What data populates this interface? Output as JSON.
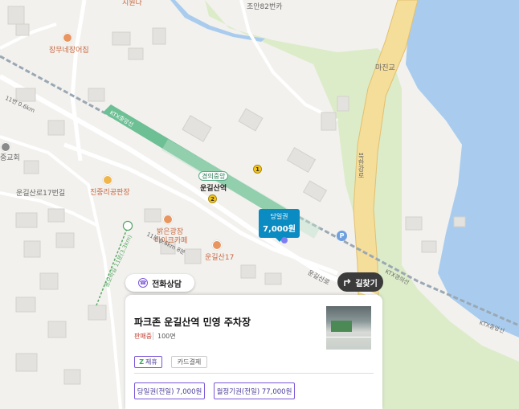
{
  "map": {
    "labels": {
      "top_cut": "지원다",
      "address_top": "조안82번카",
      "majin": "마진교",
      "road_vert": "북한강로",
      "church": "중교회",
      "road_17": "운길산로17번길",
      "road_11_left": "11번 0.6km",
      "road_11_mid": "11분 0.6km 8분",
      "path_left": "용모바길 11분(3.3km)",
      "unkil_road": "운길산로",
      "ktx_right": "KTX경의선",
      "ktx_far": "KTX중앙선",
      "ktx_green": "KTX중앙선"
    },
    "pois": {
      "restaurant": "장무네장어집",
      "jinjung": "진중리공판장",
      "balgeun_1": "밝은광장",
      "balgeun_2": "바이크카페",
      "unkil17": "운길산17"
    },
    "station": {
      "line": "경의중앙",
      "name": "운길산역",
      "exit1": "1",
      "exit2": "2"
    },
    "parking_badge": "P"
  },
  "price_tag": {
    "label": "당일권",
    "price": "7,000원"
  },
  "buttons": {
    "call": "전화상담",
    "navigate": "길찾기"
  },
  "card": {
    "title": "파크존 운길산역 민영 주차장",
    "status": "판매중",
    "spaces": "100면",
    "chips": {
      "partner": "제휴",
      "card_payment": "카드결제"
    },
    "tickets": {
      "day": "당일권(전일) 7,000원",
      "month": "월정기권(전일) 77,000원"
    }
  },
  "icons": [
    "phone-icon",
    "turn-right-icon",
    "fork-knife-icon",
    "parking-icon",
    "signpost-icon"
  ],
  "colors": {
    "water": "#a9ccee",
    "highway": "#f5dd9a",
    "rail_green": "#6dbf94",
    "accent_purple": "#7b57d8",
    "tag_blue": "#0a8bc2"
  }
}
